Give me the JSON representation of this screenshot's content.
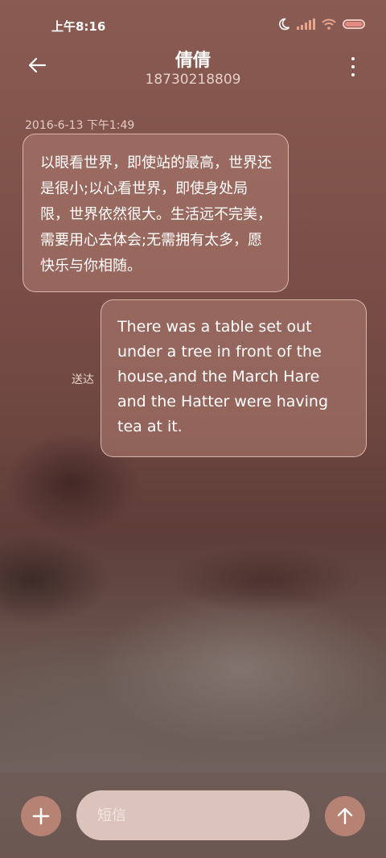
{
  "status_bar": {
    "time": "上午8:16",
    "icons": [
      "moon-icon",
      "signal-icon",
      "wifi-icon",
      "battery-icon"
    ]
  },
  "header": {
    "contact_name": "倩倩",
    "phone_number": "18730218809",
    "back_icon": "back-arrow-icon",
    "more_icon": "more-vertical-icon"
  },
  "conversation": {
    "timestamp": "2016-6-13 下午1:49",
    "messages": [
      {
        "direction": "incoming",
        "text": "以眼看世界，即使站的最高，世界还是很小;以心看世界，即使身处局限，世界依然很大。生活远不完美，需要用心去体会;无需拥有太多，愿快乐与你相随。"
      },
      {
        "direction": "outgoing",
        "text": "There was a table set out under a tree in front of the house,and the March Hare and the Hatter were having tea at it.",
        "status": "送达"
      }
    ]
  },
  "composer": {
    "placeholder": "短信",
    "value": "",
    "add_icon": "plus-icon",
    "send_icon": "arrow-up-icon"
  },
  "colors": {
    "bubble_fill": "#aa786c",
    "bubble_border": "#f0d2c8",
    "button_fill": "#b58273",
    "input_fill": "#dcc3bc",
    "battery_fill": "#e48a84"
  }
}
